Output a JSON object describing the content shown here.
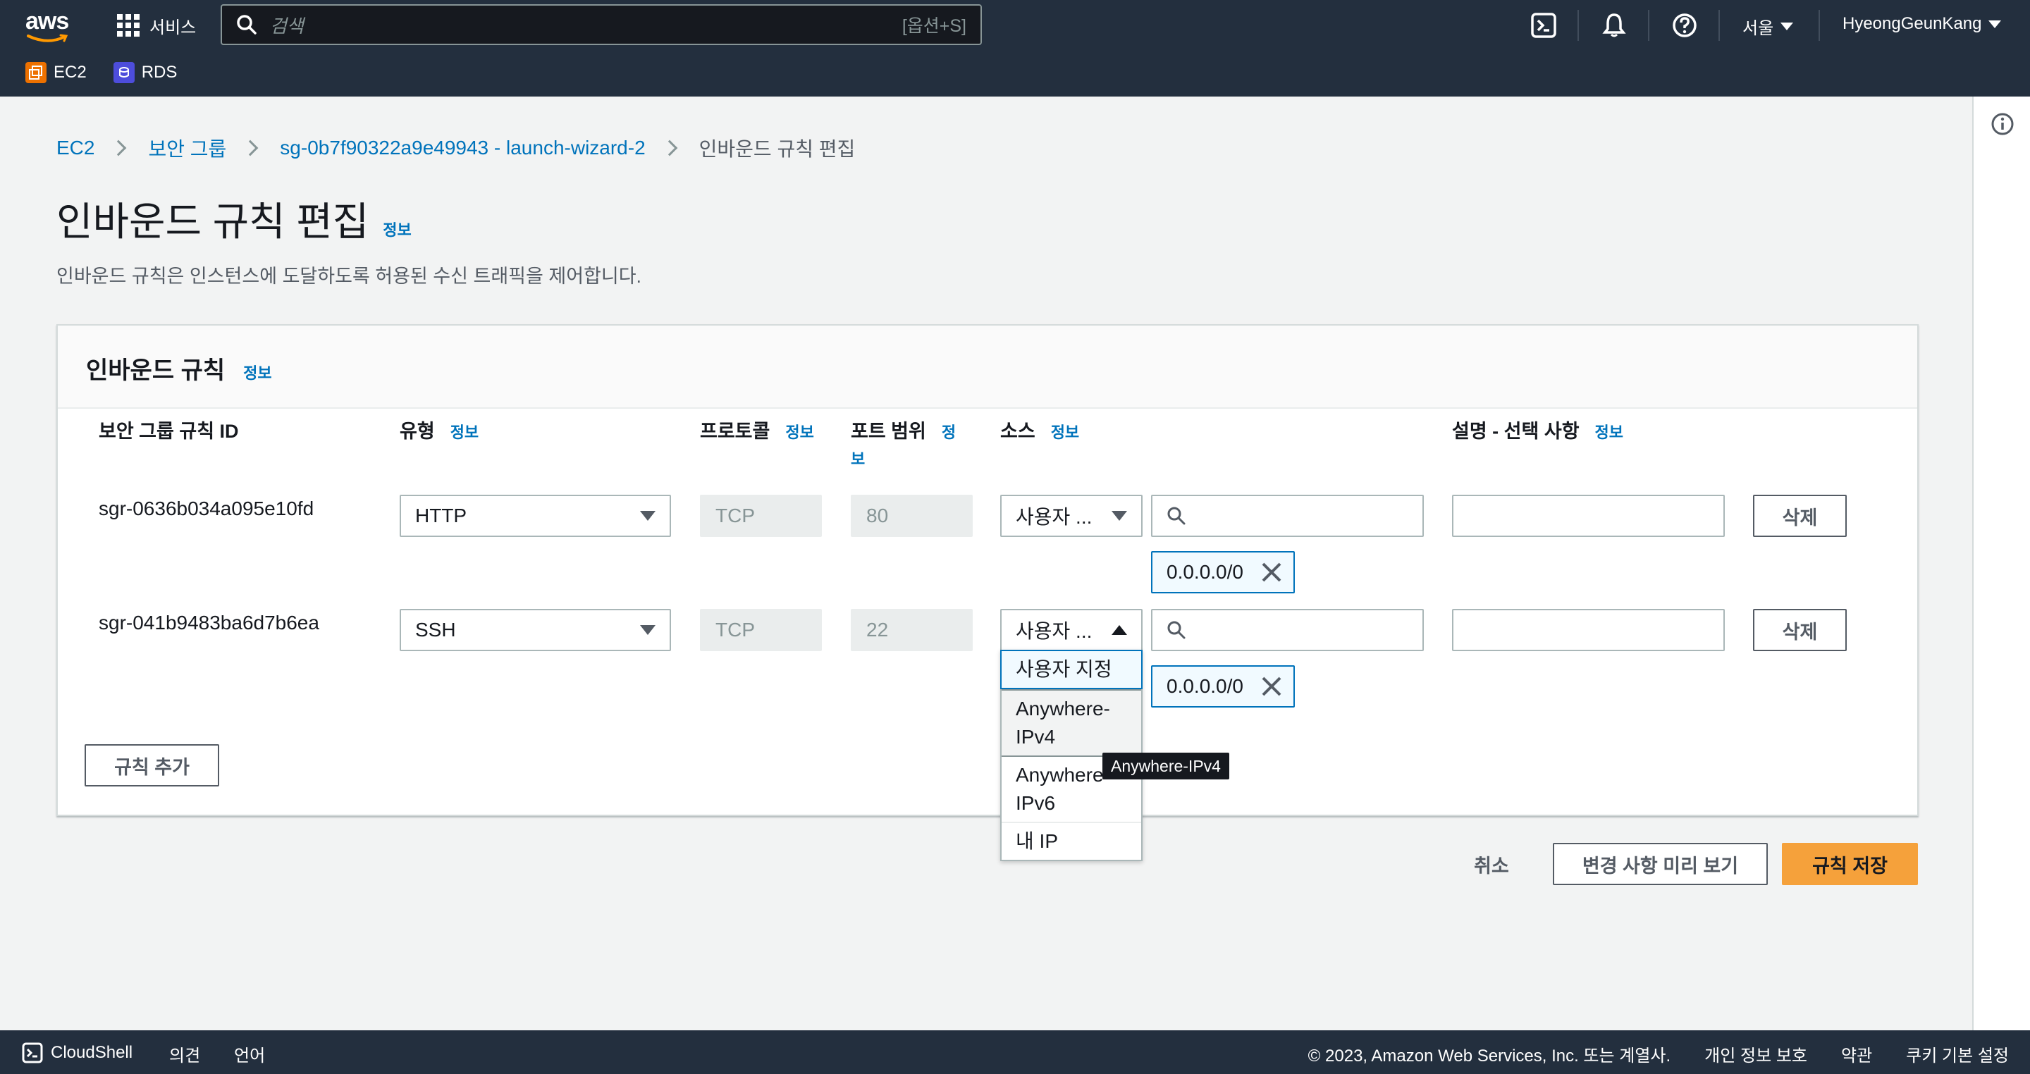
{
  "topnav": {
    "logo_text": "aws",
    "services_label": "서비스",
    "search_placeholder": "검색",
    "search_shortcut": "[옵션+S]",
    "region": "서울",
    "user": "HyeongGeunKang",
    "favorites": [
      {
        "label": "EC2",
        "color": "#ed7100"
      },
      {
        "label": "RDS",
        "color": "#4d4ddb"
      }
    ]
  },
  "breadcrumb": {
    "items": [
      "EC2",
      "보안 그룹",
      "sg-0b7f90322a9e49943 - launch-wizard-2"
    ],
    "current": "인바운드 규칙 편집"
  },
  "page": {
    "title": "인바운드 규칙 편집",
    "info": "정보",
    "description": "인바운드 규칙은 인스턴스에 도달하도록 허용된 수신 트래픽을 제어합니다."
  },
  "container": {
    "title": "인바운드 규칙",
    "info": "정보",
    "columns": {
      "rule_id": "보안 그룹 규칙 ID",
      "type": "유형",
      "protocol": "프로토콜",
      "port_range_line1": "포트 범위",
      "port_info_1": "정",
      "port_info_2": "보",
      "source": "소스",
      "description": "설명 - 선택 사항",
      "info": "정보"
    },
    "rules": [
      {
        "id": "sgr-0636b034a095e10fd",
        "type": "HTTP",
        "protocol": "TCP",
        "port": "80",
        "source_type": "사용자 ...",
        "cidr": "0.0.0.0/0",
        "description": "",
        "delete": "삭제"
      },
      {
        "id": "sgr-041b9483ba6d7b6ea",
        "type": "SSH",
        "protocol": "TCP",
        "port": "22",
        "source_type": "사용자 ...",
        "cidr": "0.0.0.0/0",
        "description": "",
        "delete": "삭제"
      }
    ],
    "add_rule": "규칙 추가"
  },
  "dropdown": {
    "options": [
      "사용자 지정",
      "Anywhere-IPv4",
      "Anywhere-IPv6",
      "내 IP"
    ],
    "opt1_line1": "Anywhere-",
    "opt1_line2": "IPv4",
    "opt2_line1": "Anywhere-",
    "opt2_line2": "IPv6",
    "selected": "사용자 지정",
    "hovered": "Anywhere-IPv4",
    "tooltip": "Anywhere-IPv4"
  },
  "actions": {
    "cancel": "취소",
    "preview": "변경 사항 미리 보기",
    "save": "규칙 저장"
  },
  "footer": {
    "cloudshell": "CloudShell",
    "feedback": "의견",
    "language": "언어",
    "copyright": "© 2023, Amazon Web Services, Inc. 또는 계열사.",
    "privacy": "개인 정보 보호",
    "terms": "약관",
    "cookies": "쿠키 기본 설정"
  },
  "colors": {
    "nav_bg": "#232f3e",
    "link": "#0073bb",
    "primary": "#f5a13b"
  }
}
